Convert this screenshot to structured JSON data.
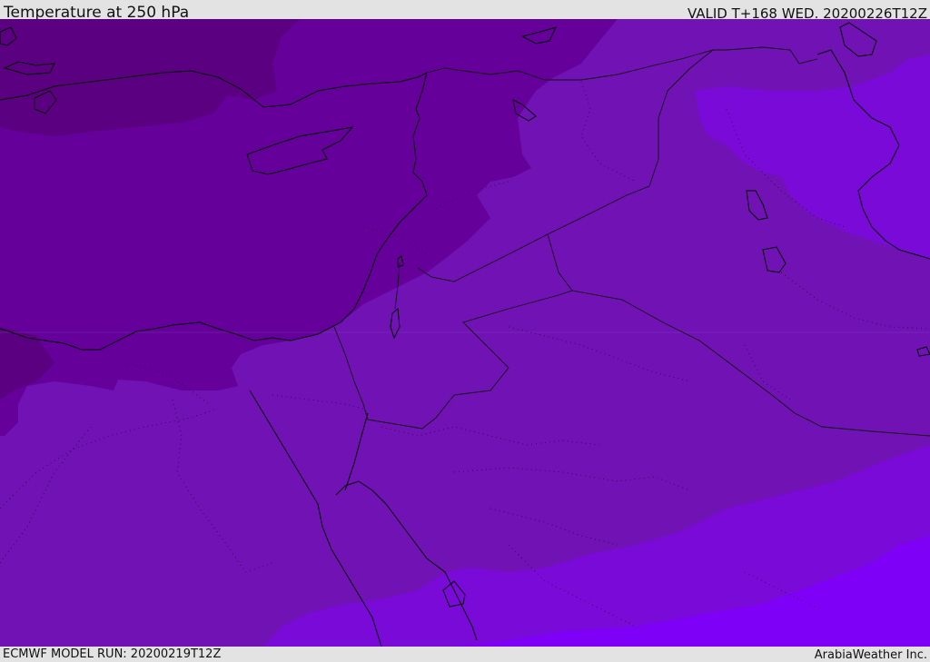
{
  "header": {
    "title": "Temperature at 250 hPa",
    "valid": "VALID T+168 WED. 20200226T12Z"
  },
  "footer": {
    "model_run": "ECMWF MODEL RUN: 20200219T12Z",
    "credit": "ArabiaWeather Inc."
  },
  "map": {
    "colors": {
      "band_darkest": "#5c0082",
      "band_dark": "#65009a",
      "band_mid": "#7112b4",
      "band_light": "#7a0ad8",
      "band_bright": "#7f00f7",
      "coastline": "#000000",
      "border": "#111111"
    }
  }
}
